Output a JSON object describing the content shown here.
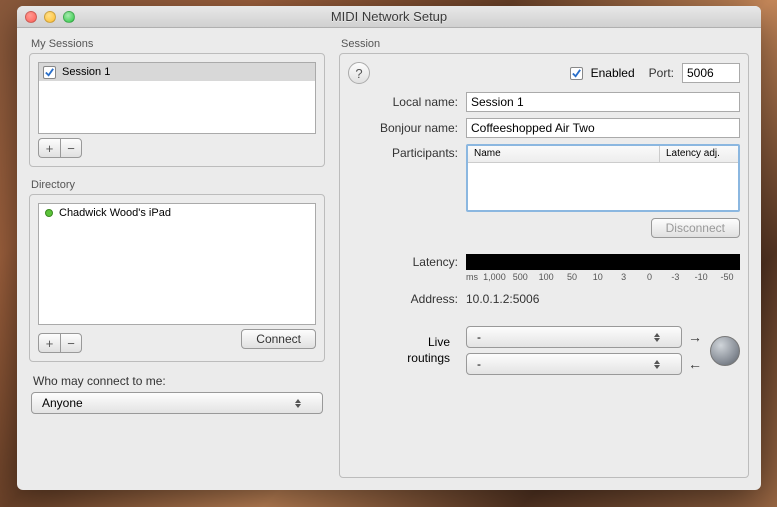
{
  "window": {
    "title": "MIDI Network Setup"
  },
  "left": {
    "my_sessions_label": "My Sessions",
    "sessions": [
      {
        "name": "Session 1",
        "checked": true
      }
    ],
    "directory_label": "Directory",
    "directory": [
      {
        "name": "Chadwick Wood's iPad",
        "online": true
      }
    ],
    "connect_label": "Connect",
    "who_label": "Who may connect to me:",
    "who_value": "Anyone"
  },
  "session": {
    "group_label": "Session",
    "enabled_label": "Enabled",
    "enabled": true,
    "port_label": "Port:",
    "port_value": "5006",
    "local_name_label": "Local name:",
    "local_name_value": "Session 1",
    "bonjour_label": "Bonjour name:",
    "bonjour_value": "Coffeeshopped Air Two",
    "participants_label": "Participants:",
    "participants_cols": {
      "name": "Name",
      "latency": "Latency adj."
    },
    "disconnect_label": "Disconnect",
    "latency_label": "Latency:",
    "latency_ticks": [
      "ms",
      "1,000",
      "500",
      "100",
      "50",
      "10",
      "3",
      "0",
      "-3",
      "-10",
      "-50"
    ],
    "address_label": "Address:",
    "address_value": "10.0.1.2:5006",
    "live_label_1": "Live",
    "live_label_2": "routings",
    "live_value_1": "-",
    "live_value_2": "-"
  }
}
